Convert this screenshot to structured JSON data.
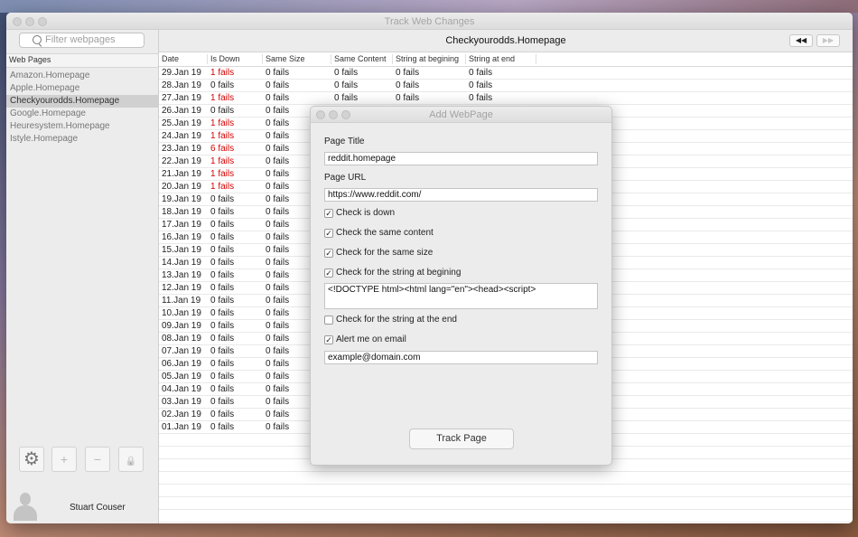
{
  "window": {
    "title": "Track Web Changes"
  },
  "sidebar": {
    "search_placeholder": "Filter webpages",
    "header": "Web Pages",
    "items": [
      {
        "label": "Amazon.Homepage",
        "selected": false
      },
      {
        "label": "Apple.Homepage",
        "selected": false
      },
      {
        "label": "Checkyourodds.Homepage",
        "selected": true
      },
      {
        "label": "Google.Homepage",
        "selected": false
      },
      {
        "label": "Heuresystem.Homepage",
        "selected": false
      },
      {
        "label": "Istyle.Homepage",
        "selected": false
      }
    ],
    "buttons": {
      "gear": "⚙",
      "add": "+",
      "remove": "−",
      "lock": "🔒"
    },
    "user_name": "Stuart Couser"
  },
  "main": {
    "title": "Checkyourodds.Homepage",
    "prev_icon": "◀◀",
    "next_icon": "▶▶",
    "columns": [
      "Date",
      "Is Down",
      "Same Size",
      "Same Content",
      "String at begining",
      "String at end"
    ],
    "rows": [
      {
        "date": "29.Jan 19",
        "down": "1 fails",
        "size": "0 fails",
        "content": "0 fails",
        "begin": "0 fails",
        "end": "0 fails",
        "down_red": true
      },
      {
        "date": "28.Jan 19",
        "down": "0 fails",
        "size": "0 fails",
        "content": "0 fails",
        "begin": "0 fails",
        "end": "0 fails",
        "down_red": false
      },
      {
        "date": "27.Jan 19",
        "down": "1 fails",
        "size": "0 fails",
        "content": "0 fails",
        "begin": "0 fails",
        "end": "0 fails",
        "down_red": true
      },
      {
        "date": "26.Jan 19",
        "down": "0 fails",
        "size": "0 fails",
        "down_red": false
      },
      {
        "date": "25.Jan 19",
        "down": "1 fails",
        "size": "0 fails",
        "down_red": true
      },
      {
        "date": "24.Jan 19",
        "down": "1 fails",
        "size": "0 fails",
        "down_red": true
      },
      {
        "date": "23.Jan 19",
        "down": "6 fails",
        "size": "0 fails",
        "down_red": true
      },
      {
        "date": "22.Jan 19",
        "down": "1 fails",
        "size": "0 fails",
        "down_red": true
      },
      {
        "date": "21.Jan 19",
        "down": "1 fails",
        "size": "0 fails",
        "down_red": true
      },
      {
        "date": "20.Jan 19",
        "down": "1 fails",
        "size": "0 fails",
        "down_red": true
      },
      {
        "date": "19.Jan 19",
        "down": "0 fails",
        "size": "0 fails",
        "down_red": false
      },
      {
        "date": "18.Jan 19",
        "down": "0 fails",
        "size": "0 fails",
        "down_red": false
      },
      {
        "date": "17.Jan 19",
        "down": "0 fails",
        "size": "0 fails",
        "down_red": false
      },
      {
        "date": "16.Jan 19",
        "down": "0 fails",
        "size": "0 fails",
        "down_red": false
      },
      {
        "date": "15.Jan 19",
        "down": "0 fails",
        "size": "0 fails",
        "down_red": false
      },
      {
        "date": "14.Jan 19",
        "down": "0 fails",
        "size": "0 fails",
        "down_red": false
      },
      {
        "date": "13.Jan 19",
        "down": "0 fails",
        "size": "0 fails",
        "down_red": false
      },
      {
        "date": "12.Jan 19",
        "down": "0 fails",
        "size": "0 fails",
        "down_red": false
      },
      {
        "date": "11.Jan 19",
        "down": "0 fails",
        "size": "0 fails",
        "down_red": false
      },
      {
        "date": "10.Jan 19",
        "down": "0 fails",
        "size": "0 fails",
        "down_red": false
      },
      {
        "date": "09.Jan 19",
        "down": "0 fails",
        "size": "0 fails",
        "down_red": false
      },
      {
        "date": "08.Jan 19",
        "down": "0 fails",
        "size": "0 fails",
        "down_red": false
      },
      {
        "date": "07.Jan 19",
        "down": "0 fails",
        "size": "0 fails",
        "down_red": false
      },
      {
        "date": "06.Jan 19",
        "down": "0 fails",
        "size": "0 fails",
        "down_red": false
      },
      {
        "date": "05.Jan 19",
        "down": "0 fails",
        "size": "0 fails",
        "down_red": false
      },
      {
        "date": "04.Jan 19",
        "down": "0 fails",
        "size": "0 fails",
        "down_red": false
      },
      {
        "date": "03.Jan 19",
        "down": "0 fails",
        "size": "0 fails",
        "down_red": false
      },
      {
        "date": "02.Jan 19",
        "down": "0 fails",
        "size": "0 fails",
        "down_red": false
      },
      {
        "date": "01.Jan 19",
        "down": "0 fails",
        "size": "0 fails",
        "down_red": false
      }
    ],
    "empty_rows": 7
  },
  "dialog": {
    "title": "Add WebPage",
    "page_title_label": "Page Title",
    "page_title_value": "reddit.homepage",
    "page_url_label": "Page URL",
    "page_url_value": "https://www.reddit.com/",
    "check_is_down": {
      "label": "Check is down",
      "checked": true
    },
    "check_same_content": {
      "label": "Check the same content",
      "checked": true
    },
    "check_same_size": {
      "label": "Check for the same size",
      "checked": true
    },
    "check_string_begin": {
      "label": "Check for the string at begining",
      "checked": true
    },
    "string_begin_value": "<!DOCTYPE html><html lang=\"en\"><head><script>",
    "check_string_end": {
      "label": "Check for the string at the end",
      "checked": false
    },
    "alert_email": {
      "label": "Alert me on email",
      "checked": true
    },
    "email_value": "example@domain.com",
    "track_button": "Track Page"
  },
  "colors": {
    "fail_red": "#d40000",
    "selection_gray": "#d0d0d0"
  }
}
